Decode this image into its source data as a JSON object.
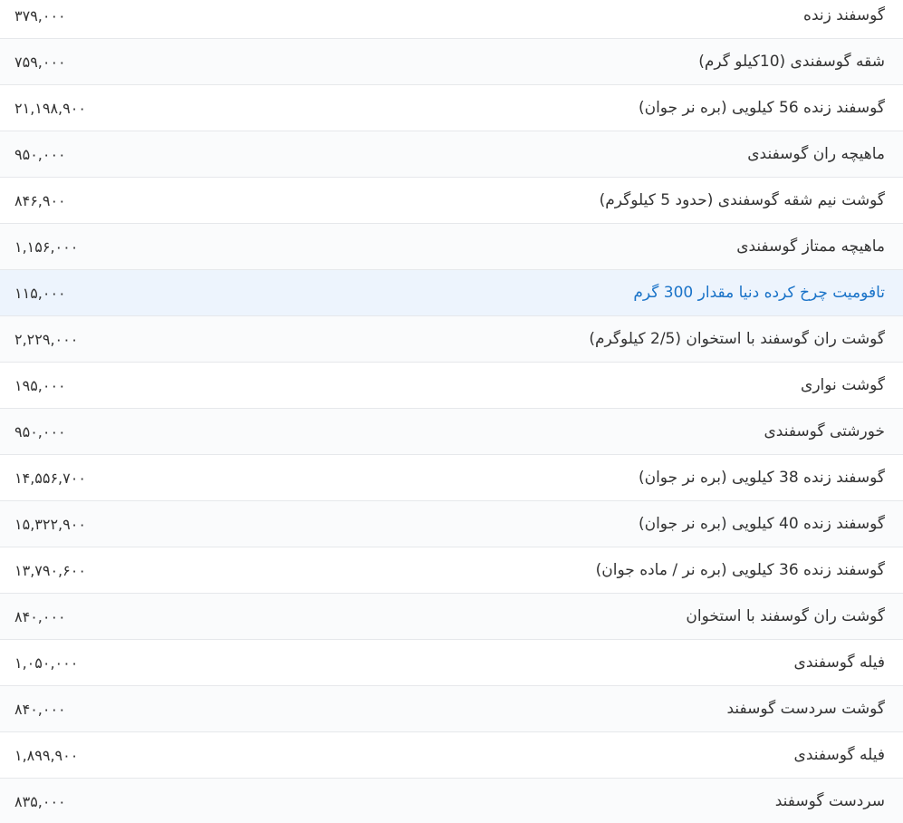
{
  "highlight_color": "#1a73c8",
  "rows": [
    {
      "name": "گوسفند زنده",
      "price": "۳۷۹,۰۰۰"
    },
    {
      "name": "شقه گوسفندی (10کیلو گرم)",
      "price": "۷۵۹,۰۰۰"
    },
    {
      "name": "گوسفند زنده 56 کیلویی (بره نر جوان)",
      "price": "۲۱,۱۹۸,۹۰۰"
    },
    {
      "name": "ماهیچه ران گوسفندی",
      "price": "۹۵۰,۰۰۰"
    },
    {
      "name": "گوشت نیم شقه گوسفندی (حدود 5 کیلوگرم)",
      "price": "۸۴۶,۹۰۰"
    },
    {
      "name": "ماهیچه ممتاز گوسفندی",
      "price": "۱,۱۵۶,۰۰۰"
    },
    {
      "name": "تافومیت چرخ کرده دنیا مقدار 300 گرم",
      "price": "۱۱۵,۰۰۰"
    },
    {
      "name": "گوشت ران گوسفند با استخوان (2/5 کیلوگرم)",
      "price": "۲,۲۲۹,۰۰۰"
    },
    {
      "name": "گوشت نواری",
      "price": "۱۹۵,۰۰۰"
    },
    {
      "name": "خورشتی گوسفندی",
      "price": "۹۵۰,۰۰۰"
    },
    {
      "name": "گوسفند زنده 38 کیلویی (بره نر جوان)",
      "price": "۱۴,۵۵۶,۷۰۰"
    },
    {
      "name": "گوسفند زنده 40 کیلویی (بره نر جوان)",
      "price": "۱۵,۳۲۲,۹۰۰"
    },
    {
      "name": "گوسفند زنده 36 کیلویی (بره نر / ماده جوان)",
      "price": "۱۳,۷۹۰,۶۰۰"
    },
    {
      "name": "گوشت ران گوسفند با استخوان",
      "price": "۸۴۰,۰۰۰"
    },
    {
      "name": "فیله گوسفندی",
      "price": "۱,۰۵۰,۰۰۰"
    },
    {
      "name": "گوشت سردست گوسفند",
      "price": "۸۴۰,۰۰۰"
    },
    {
      "name": "فیله گوسفندی",
      "price": "۱,۸۹۹,۹۰۰"
    },
    {
      "name": "سردست گوسفند",
      "price": "۸۳۵,۰۰۰"
    }
  ]
}
